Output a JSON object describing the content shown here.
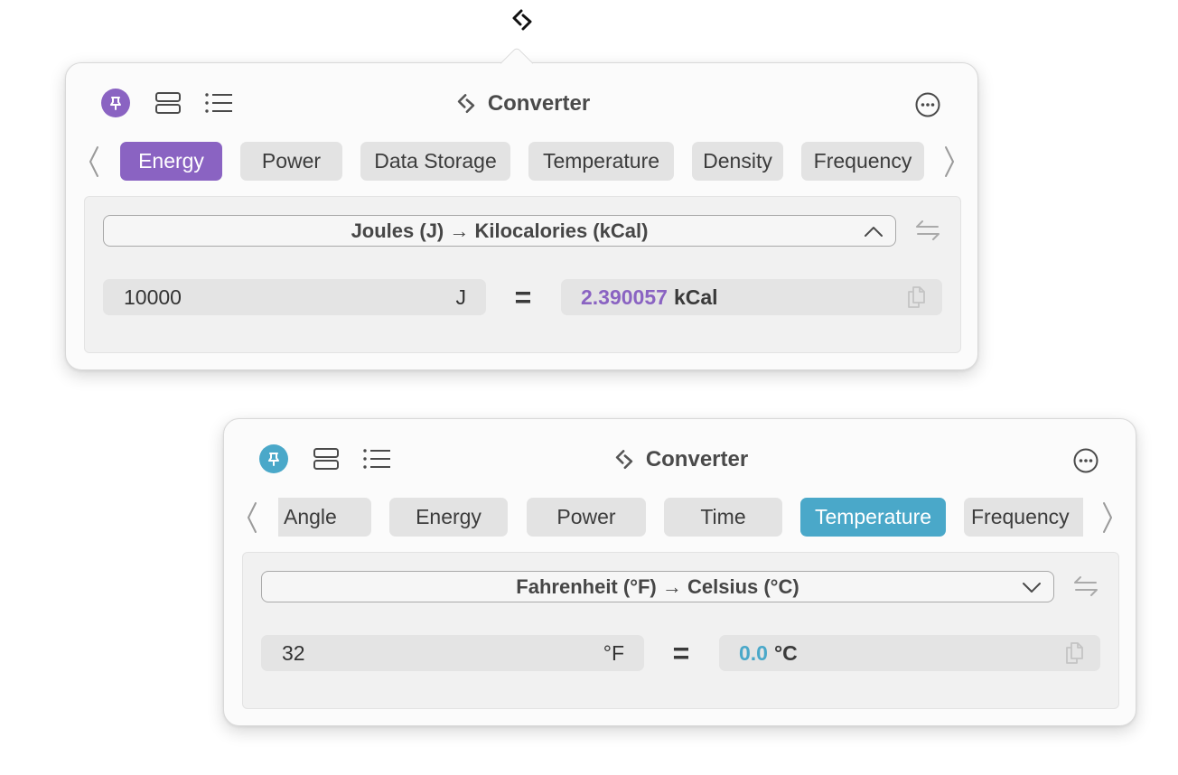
{
  "menubar": {
    "icon": "converter-icon"
  },
  "panels": [
    {
      "accent": "#8a63c2",
      "title": "Converter",
      "tabs": [
        "Energy",
        "Power",
        "Data Storage",
        "Temperature",
        "Density",
        "Frequency"
      ],
      "active_tab": "Energy",
      "conversion": "Joules (J) → Kilocalories (kCal)",
      "dropdown_state": "expanded",
      "input_value": "10000",
      "input_unit": "J",
      "equals": "=",
      "result_value": "2.390057",
      "result_unit": "kCal"
    },
    {
      "accent": "#4aa8c9",
      "title": "Converter",
      "tabs": [
        "Angle",
        "Energy",
        "Power",
        "Time",
        "Temperature",
        "Frequency"
      ],
      "active_tab": "Temperature",
      "conversion": "Fahrenheit (°F) → Celsius (°C)",
      "dropdown_state": "collapsed",
      "input_value": "32",
      "input_unit": "°F",
      "equals": "=",
      "result_value": "0.0",
      "result_unit": "°C"
    }
  ]
}
